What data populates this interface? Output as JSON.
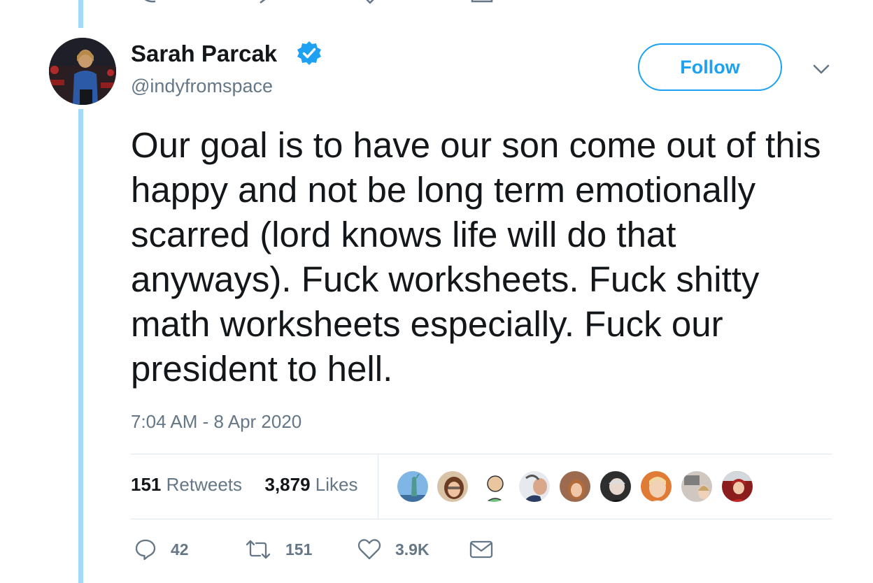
{
  "tweet": {
    "author_name": "Sarah Parcak",
    "handle": "@indyfromspace",
    "verified": true,
    "follow_label": "Follow",
    "text": "Our goal is to have our son come out of this happy and not be long term emotionally scarred (lord knows life will do that anyways). Fuck worksheets. Fuck shitty math worksheets especially. Fuck our president to hell.",
    "timestamp": "7:04 AM - 8 Apr 2020"
  },
  "stats": {
    "retweets_count": "151",
    "retweets_label": "Retweets",
    "likes_count": "3,879",
    "likes_label": "Likes"
  },
  "likers": [
    {
      "name": "liker-1",
      "bg": "#6fa8dc"
    },
    {
      "name": "liker-2",
      "bg": "#c9a27e"
    },
    {
      "name": "liker-3",
      "bg": "#8fc98f"
    },
    {
      "name": "liker-4",
      "bg": "#a8b4c4"
    },
    {
      "name": "liker-5",
      "bg": "#b58363"
    },
    {
      "name": "liker-6",
      "bg": "#4a4a4a"
    },
    {
      "name": "liker-7",
      "bg": "#d98a4a"
    },
    {
      "name": "liker-8",
      "bg": "#c7c0bb"
    },
    {
      "name": "liker-9",
      "bg": "#b23a3a"
    }
  ],
  "actions": {
    "replies": "42",
    "retweets": "151",
    "likes": "3.9K"
  },
  "colors": {
    "accent": "#1da1f2",
    "thread_line": "#a4d9f7",
    "text": "#14171a",
    "secondary_text": "#657786",
    "divider": "#e1e8ed"
  },
  "icons": {
    "verified": "verified-badge-icon",
    "caret": "chevron-down-icon",
    "reply": "reply-icon",
    "retweet": "retweet-icon",
    "like": "heart-icon",
    "dm": "envelope-icon"
  }
}
